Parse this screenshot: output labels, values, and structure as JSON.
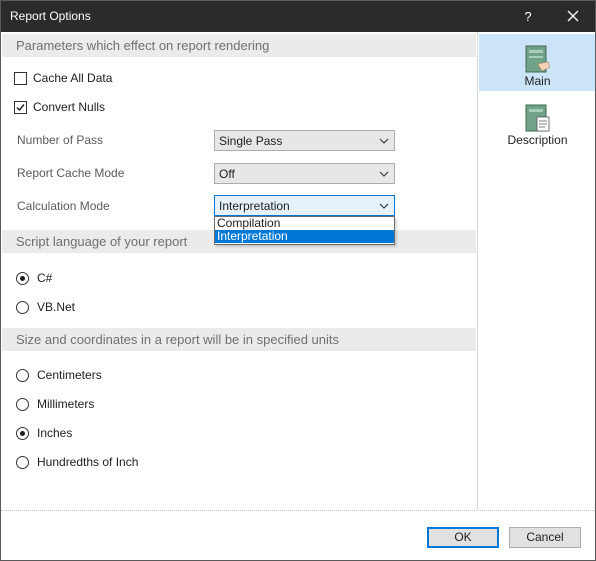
{
  "window": {
    "title": "Report Options",
    "help": "?"
  },
  "sections": {
    "rendering": "Parameters which effect on report rendering",
    "script": "Script language of your report",
    "units": "Size and coordinates in a report will be in specified units"
  },
  "checkboxes": [
    {
      "label": "Cache All Data",
      "checked": false
    },
    {
      "label": "Convert Nulls",
      "checked": true
    }
  ],
  "fields": {
    "pass": {
      "label": "Number of Pass",
      "value": "Single Pass"
    },
    "cache_mode": {
      "label": "Report Cache Mode",
      "value": "Off"
    },
    "calc_mode": {
      "label": "Calculation Mode",
      "value": "Interpretation",
      "options": [
        "Compilation",
        "Interpretation"
      ]
    }
  },
  "script_languages": [
    {
      "label": "C#",
      "selected": true
    },
    {
      "label": "VB.Net",
      "selected": false
    }
  ],
  "units": [
    {
      "label": "Centimeters",
      "selected": false
    },
    {
      "label": "Millimeters",
      "selected": false
    },
    {
      "label": "Inches",
      "selected": true
    },
    {
      "label": "Hundredths of Inch",
      "selected": false
    }
  ],
  "nav": [
    {
      "label": "Main",
      "icon": "main-page-icon",
      "active": true
    },
    {
      "label": "Description",
      "icon": "description-page-icon",
      "active": false
    }
  ],
  "buttons": {
    "ok": "OK",
    "cancel": "Cancel"
  },
  "colors": {
    "accent": "#0078d7",
    "titlebar": "#2b2b2b",
    "section_bg": "#ebebeb",
    "nav_active": "#cce4f7"
  }
}
